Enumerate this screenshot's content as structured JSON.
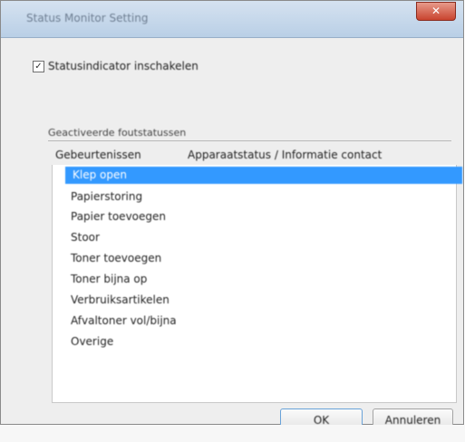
{
  "window": {
    "title": "Status Monitor Setting",
    "close_symbol": "✕"
  },
  "checkbox": {
    "label": "Statusindicator inschakelen",
    "checked": true,
    "mark": "✓"
  },
  "group": {
    "label": "Geactiveerde foutstatussen"
  },
  "list": {
    "header_col1": "Gebeurtenissen",
    "header_col2": "Apparaatstatus / Informatie contact",
    "items": [
      {
        "label": "Klep open",
        "selected": true
      },
      {
        "label": "Papierstoring",
        "selected": false
      },
      {
        "label": "Papier toevoegen",
        "selected": false
      },
      {
        "label": "Stoor",
        "selected": false
      },
      {
        "label": "Toner toevoegen",
        "selected": false
      },
      {
        "label": "Toner bijna op",
        "selected": false
      },
      {
        "label": "Verbruiksartikelen",
        "selected": false
      },
      {
        "label": "Afvaltoner vol/bijna",
        "selected": false
      },
      {
        "label": "Overige",
        "selected": false
      }
    ]
  },
  "buttons": {
    "ok": "OK",
    "cancel": "Annuleren"
  },
  "colors": {
    "selection": "#3399ff",
    "close_button": "#c9442f"
  }
}
